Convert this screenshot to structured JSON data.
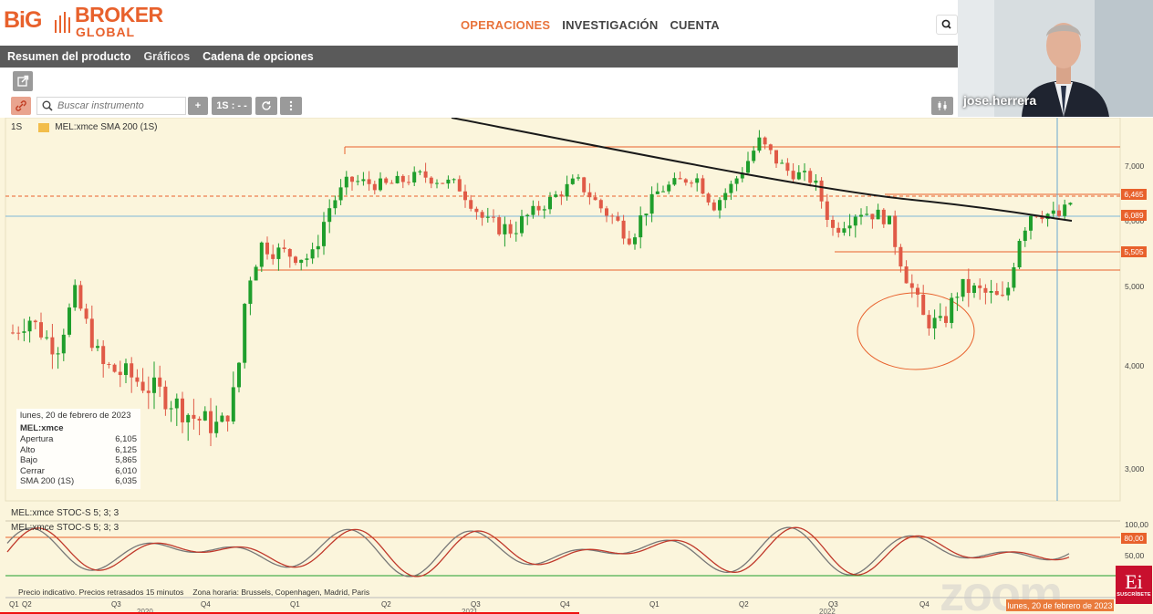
{
  "header": {
    "logo_big": "BiG",
    "logo_broker": "BROKER",
    "logo_global": "GLOBAL",
    "nav": [
      {
        "label": "OPERACIONES",
        "active": true
      },
      {
        "label": "INVESTIGACIÓN",
        "active": false
      },
      {
        "label": "CUENTA",
        "active": false
      }
    ]
  },
  "subnav": {
    "items": [
      "Resumen del producto",
      "Gráficos",
      "Cadena de opciones"
    ]
  },
  "toolbar": {
    "search_placeholder": "Buscar instrumento",
    "plus_label": "+",
    "period_label": "1S : - -",
    "refresh_icon": "refresh-icon",
    "more_icon": "vertical-dots-icon"
  },
  "chart": {
    "interval": "1S",
    "overlay_legend": "MEL:xmce SMA 200 (1S)",
    "stoch_label_1": "MEL:xmce STOC-S 5; 3; 3",
    "stoch_label_2": "MEL:xmce STOC-S 5; 3; 3",
    "price_ticks": [
      "7,000",
      "6,000",
      "5,000",
      "4,000",
      "3,000"
    ],
    "price_tags": [
      {
        "value": "6,465",
        "color": "#e8612c"
      },
      {
        "value": "6,089",
        "color": "#e8612c"
      },
      {
        "value": "5,505",
        "color": "#e8612c"
      }
    ],
    "stoch_ticks": [
      "100,00",
      "80,00",
      "50,00"
    ],
    "stoch_tag": "80,00",
    "x_quarters": [
      "Q1",
      "Q2",
      "Q3",
      "Q4",
      "Q1",
      "Q2",
      "Q3",
      "Q4",
      "Q1",
      "Q2",
      "Q3",
      "Q4"
    ],
    "x_years": [
      "2020",
      "2021",
      "2022"
    ],
    "info_box": {
      "date": "lunes, 20 de febrero de 2023",
      "symbol": "MEL:xmce",
      "rows": [
        {
          "label": "Apertura",
          "value": "6,105"
        },
        {
          "label": "Alto",
          "value": "6,125"
        },
        {
          "label": "Bajo",
          "value": "5,865"
        },
        {
          "label": "Cerrar",
          "value": "6,010"
        },
        {
          "label": "SMA 200 (1S)",
          "value": "6,035"
        }
      ]
    },
    "footer": {
      "precio": "Precio indicativo. Precios retrasados 15 minutos",
      "zona": "Zona horaria: Brussels, Copenhagen, Madrid, Paris"
    },
    "cursor_date": "lunes, 20 de febrero de 2023"
  },
  "webcam": {
    "name": "jose.herrera"
  },
  "badge": {
    "logo": "Ei",
    "label": "SUSCRÍBETE"
  },
  "colors": {
    "accent": "#e8612c",
    "up": "#1f9e2c",
    "down": "#e05a47",
    "chart_bg": "#fbf5dc"
  }
}
